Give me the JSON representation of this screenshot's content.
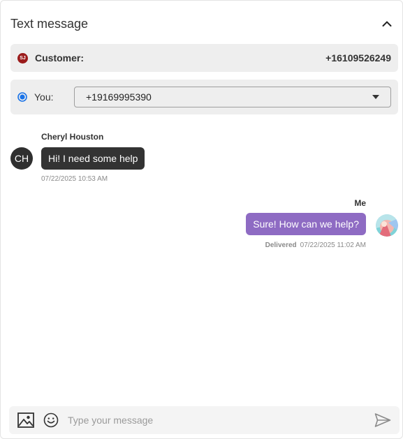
{
  "header": {
    "title": "Text message",
    "collapse_icon": "chevron-up-icon"
  },
  "customer": {
    "avatar_initials": "SJ",
    "label": "Customer:",
    "phone": "+16109526249",
    "avatar_color": "#9b1b1b"
  },
  "you": {
    "label": "You:",
    "selected_phone": "+19169995390",
    "radio_color": "#1a73e8"
  },
  "messages": [
    {
      "direction": "incoming",
      "sender": "Cheryl Houston",
      "avatar_initials": "CH",
      "text": "Hi! I need some help",
      "timestamp": "07/22/2025 10:53 AM",
      "bubble_color": "#333333"
    },
    {
      "direction": "outgoing",
      "sender": "Me",
      "text": "Sure! How can we help?",
      "status": "Delivered",
      "timestamp": "07/22/2025 11:02 AM",
      "bubble_color": "#8e6bc3"
    }
  ],
  "composer": {
    "placeholder": "Type your message",
    "attach_icon": "image-icon",
    "emoji_icon": "emoji-icon",
    "send_icon": "send-icon"
  }
}
